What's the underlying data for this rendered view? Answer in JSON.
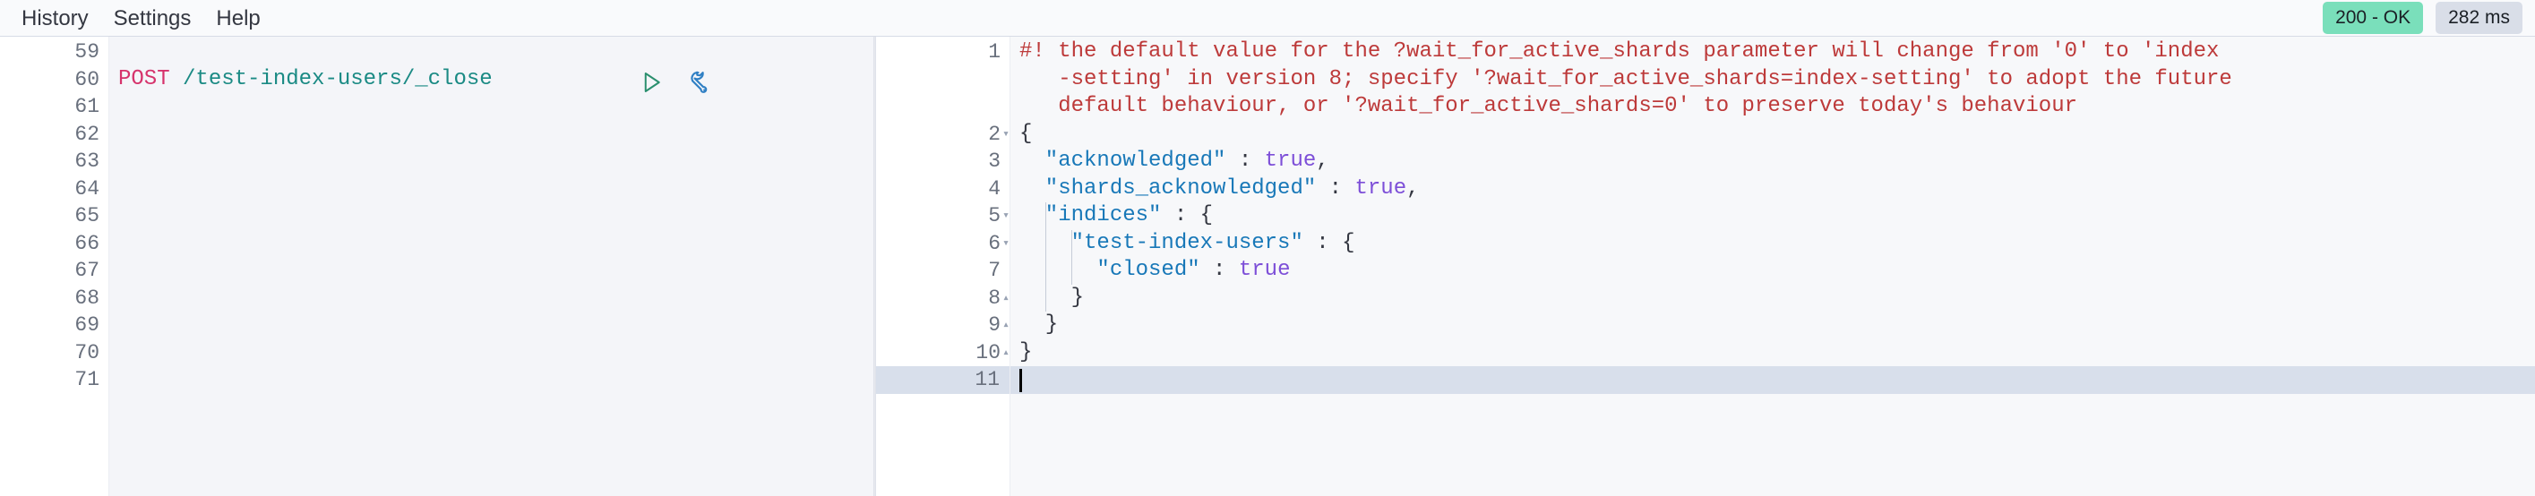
{
  "topbar": {
    "nav": [
      {
        "label": "History",
        "name": "nav-history"
      },
      {
        "label": "Settings",
        "name": "nav-settings"
      },
      {
        "label": "Help",
        "name": "nav-help"
      }
    ],
    "status_badge": "200 - OK",
    "time_badge": "282 ms",
    "status_color": "#7adfbb",
    "time_color": "#d9dee8"
  },
  "editor": {
    "gutter_lines": [
      "59",
      "60",
      "61",
      "62",
      "63",
      "64",
      "65",
      "66",
      "67",
      "68",
      "69",
      "70",
      "71"
    ],
    "request": {
      "method": "POST",
      "path": " /test-index-users/_close",
      "line_index": 1
    },
    "actions": {
      "play_label": "play-request",
      "wrench_label": "request-options"
    }
  },
  "response": {
    "lines": [
      {
        "number": "1",
        "fold": "",
        "type": "warning",
        "segments": [
          {
            "cls": "tok-warn",
            "text": "#! the default value for the ?wait_for_active_shards parameter will change from '0' to 'index"
          }
        ]
      },
      {
        "number": "",
        "fold": "",
        "type": "warning",
        "segments": [
          {
            "cls": "tok-warn",
            "text": "   -setting' in version 8; specify '?wait_for_active_shards=index-setting' to adopt the future"
          }
        ]
      },
      {
        "number": "",
        "fold": "",
        "type": "warning",
        "segments": [
          {
            "cls": "tok-warn",
            "text": "   default behaviour, or '?wait_for_active_shards=0' to preserve today's behaviour"
          }
        ]
      },
      {
        "number": "2",
        "fold": "▾",
        "type": "json",
        "segments": [
          {
            "cls": "tok-brace",
            "text": "{"
          }
        ]
      },
      {
        "number": "3",
        "fold": "",
        "type": "json",
        "segments": [
          {
            "cls": "tok-key",
            "text": "  \"acknowledged\""
          },
          {
            "cls": "tok-punct",
            "text": " : "
          },
          {
            "cls": "tok-bool",
            "text": "true"
          },
          {
            "cls": "tok-punct",
            "text": ","
          }
        ]
      },
      {
        "number": "4",
        "fold": "",
        "type": "json",
        "segments": [
          {
            "cls": "tok-key",
            "text": "  \"shards_acknowledged\""
          },
          {
            "cls": "tok-punct",
            "text": " : "
          },
          {
            "cls": "tok-bool",
            "text": "true"
          },
          {
            "cls": "tok-punct",
            "text": ","
          }
        ]
      },
      {
        "number": "5",
        "fold": "▾",
        "type": "json",
        "segments": [
          {
            "cls": "tok-key",
            "text": "  \"indices\""
          },
          {
            "cls": "tok-punct",
            "text": " : "
          },
          {
            "cls": "tok-brace",
            "text": "{"
          }
        ]
      },
      {
        "number": "6",
        "fold": "▾",
        "type": "json",
        "segments": [
          {
            "cls": "tok-key",
            "text": "    \"test-index-users\""
          },
          {
            "cls": "tok-punct",
            "text": " : "
          },
          {
            "cls": "tok-brace",
            "text": "{"
          }
        ]
      },
      {
        "number": "7",
        "fold": "",
        "type": "json",
        "segments": [
          {
            "cls": "tok-key",
            "text": "      \"closed\""
          },
          {
            "cls": "tok-punct",
            "text": " : "
          },
          {
            "cls": "tok-bool",
            "text": "true"
          }
        ]
      },
      {
        "number": "8",
        "fold": "▴",
        "type": "json",
        "segments": [
          {
            "cls": "tok-brace",
            "text": "    }"
          }
        ]
      },
      {
        "number": "9",
        "fold": "▴",
        "type": "json",
        "segments": [
          {
            "cls": "tok-brace",
            "text": "  }"
          }
        ]
      },
      {
        "number": "10",
        "fold": "▴",
        "type": "json",
        "segments": [
          {
            "cls": "tok-brace",
            "text": "}"
          }
        ]
      },
      {
        "number": "11",
        "fold": "",
        "type": "cursor",
        "segments": []
      }
    ]
  }
}
